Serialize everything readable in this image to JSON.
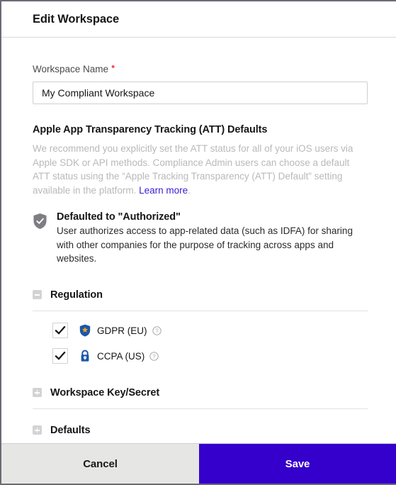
{
  "header": {
    "title": "Edit Workspace"
  },
  "form": {
    "workspace_name": {
      "label": "Workspace Name",
      "required_marker": "•",
      "value": "My Compliant Workspace",
      "placeholder": "Workspace Name"
    }
  },
  "att_section": {
    "heading": "Apple App Transparency Tracking (ATT) Defaults",
    "helper_text_before_link": "We recommend you explicitly set the ATT status for all of your iOS users via Apple SDK or API methods. Compliance Admin users can choose a default ATT status using the “Apple Tracking Transparency (ATT) Default” setting available in the platform. ",
    "helper_link_label": "Learn more",
    "helper_text_after_link": ".",
    "default_state": {
      "icon": "shield-check-icon",
      "title": "Defaulted to \"Authorized\"",
      "description": "User authorizes access to app-related data (such as IDFA) for sharing with other companies for the purpose of tracking across apps and websites."
    }
  },
  "accordions": [
    {
      "label": "Regulation",
      "toggle_icon": "minus-square-icon",
      "expanded": true
    },
    {
      "label": "Workspace Key/Secret",
      "toggle_icon": "plus-square-icon",
      "expanded": false
    },
    {
      "label": "Defaults",
      "toggle_icon": "plus-square-icon",
      "expanded": false
    }
  ],
  "regulations": [
    {
      "label": "GDPR (EU)",
      "checked": true,
      "icon": "shield-star-icon",
      "help_icon": "question-circle-icon"
    },
    {
      "label": "CCPA (US)",
      "checked": true,
      "icon": "lock-icon",
      "help_icon": "question-circle-icon"
    }
  ],
  "footer": {
    "cancel_label": "Cancel",
    "save_label": "Save"
  },
  "colors": {
    "accent": "#3500cc",
    "link": "#3b1bd4",
    "required": "#f4505a",
    "regulation_icon": "#1a57a8",
    "star": "#f0a31e",
    "shield_gray": "#7d7d83",
    "cancel_bg": "#e6e6e5"
  }
}
